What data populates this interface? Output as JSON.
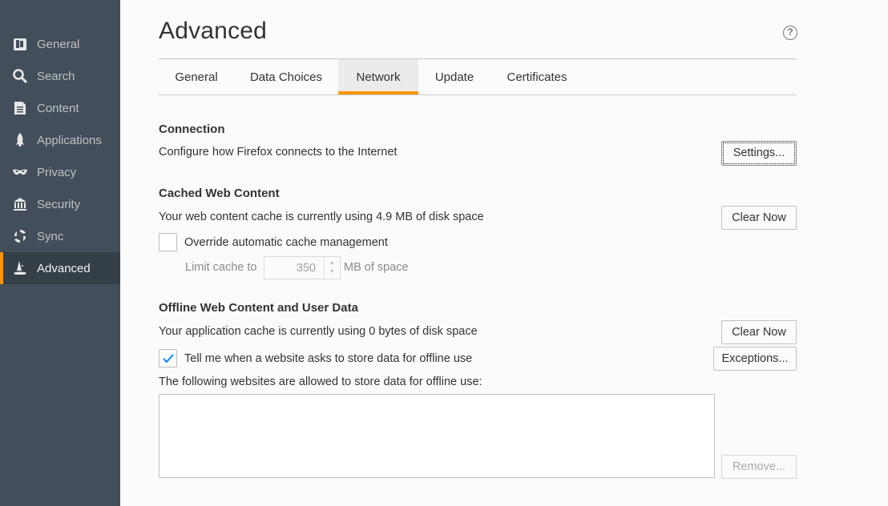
{
  "sidebar": {
    "items": [
      {
        "label": "General",
        "icon": "general-icon"
      },
      {
        "label": "Search",
        "icon": "search-icon"
      },
      {
        "label": "Content",
        "icon": "content-icon"
      },
      {
        "label": "Applications",
        "icon": "applications-icon"
      },
      {
        "label": "Privacy",
        "icon": "privacy-mask-icon"
      },
      {
        "label": "Security",
        "icon": "security-icon"
      },
      {
        "label": "Sync",
        "icon": "sync-icon"
      },
      {
        "label": "Advanced",
        "icon": "advanced-wizard-hat-icon",
        "active": true
      }
    ]
  },
  "header": {
    "title": "Advanced",
    "help": "?"
  },
  "tabs": [
    {
      "label": "General"
    },
    {
      "label": "Data Choices"
    },
    {
      "label": "Network",
      "active": true
    },
    {
      "label": "Update"
    },
    {
      "label": "Certificates"
    }
  ],
  "connection": {
    "title": "Connection",
    "description": "Configure how Firefox connects to the Internet",
    "settings_button": "Settings..."
  },
  "cached": {
    "title": "Cached Web Content",
    "description": "Your web content cache is currently using 4.9 MB of disk space",
    "clear_button": "Clear Now",
    "override_label": "Override automatic cache management",
    "override_checked": false,
    "limit_label": "Limit cache to",
    "limit_value": "350",
    "limit_unit": "MB of space"
  },
  "offline": {
    "title": "Offline Web Content and User Data",
    "description": "Your application cache is currently using 0 bytes of disk space",
    "clear_button": "Clear Now",
    "tell_label": "Tell me when a website asks to store data for offline use",
    "tell_checked": true,
    "exceptions_button": "Exceptions...",
    "list_label": "The following websites are allowed to store data for offline use:",
    "remove_button": "Remove..."
  },
  "colors": {
    "sidebar_bg": "#424f5a",
    "accent": "#ff9500",
    "checkmark": "#0a84ff"
  }
}
